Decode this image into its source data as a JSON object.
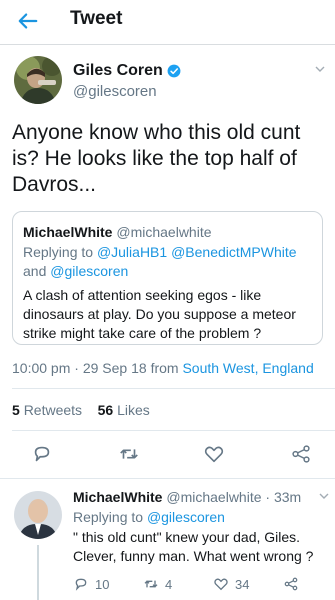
{
  "header": {
    "title": "Tweet"
  },
  "tweet": {
    "author_name": "Giles Coren",
    "author_handle": "@gilescoren",
    "text": "Anyone know who this old cunt is? He looks like the top half of Davros...",
    "time": "10:00 pm",
    "date": "29 Sep 18",
    "source_prefix": "from",
    "location": "South West, England",
    "retweets_count": "5",
    "retweets_label": "Retweets",
    "likes_count": "56",
    "likes_label": "Likes"
  },
  "quote": {
    "name": "MichaelWhite",
    "handle": "@michaelwhite",
    "replying_prefix": "Replying to",
    "replying_users": [
      "@JuliaHB1",
      "@BenedictMPWhite"
    ],
    "replying_and": "and",
    "replying_last": "@gilescoren",
    "text": "A clash of attention seeking egos - like dinosaurs at play. Do you suppose a meteor strike might take care of the problem ?"
  },
  "reply": {
    "name": "MichaelWhite",
    "handle": "@michaelwhite",
    "time": "33m",
    "replying_prefix": "Replying to",
    "replying_user": "@gilescoren",
    "text": "\" this old cunt\" knew your dad, Giles. Clever, funny man. What went wrong ?",
    "reply_count": "10",
    "retweet_count": "4",
    "like_count": "34"
  },
  "icons": {
    "back": "arrow-left-icon",
    "verified": "verified-badge-icon",
    "more": "chevron-down-icon",
    "reply": "reply-icon",
    "retweet": "retweet-icon",
    "like": "heart-icon",
    "share": "share-icon"
  },
  "colors": {
    "accent": "#1b95e0",
    "secondary_text": "#657786",
    "primary_text": "#14171a"
  }
}
